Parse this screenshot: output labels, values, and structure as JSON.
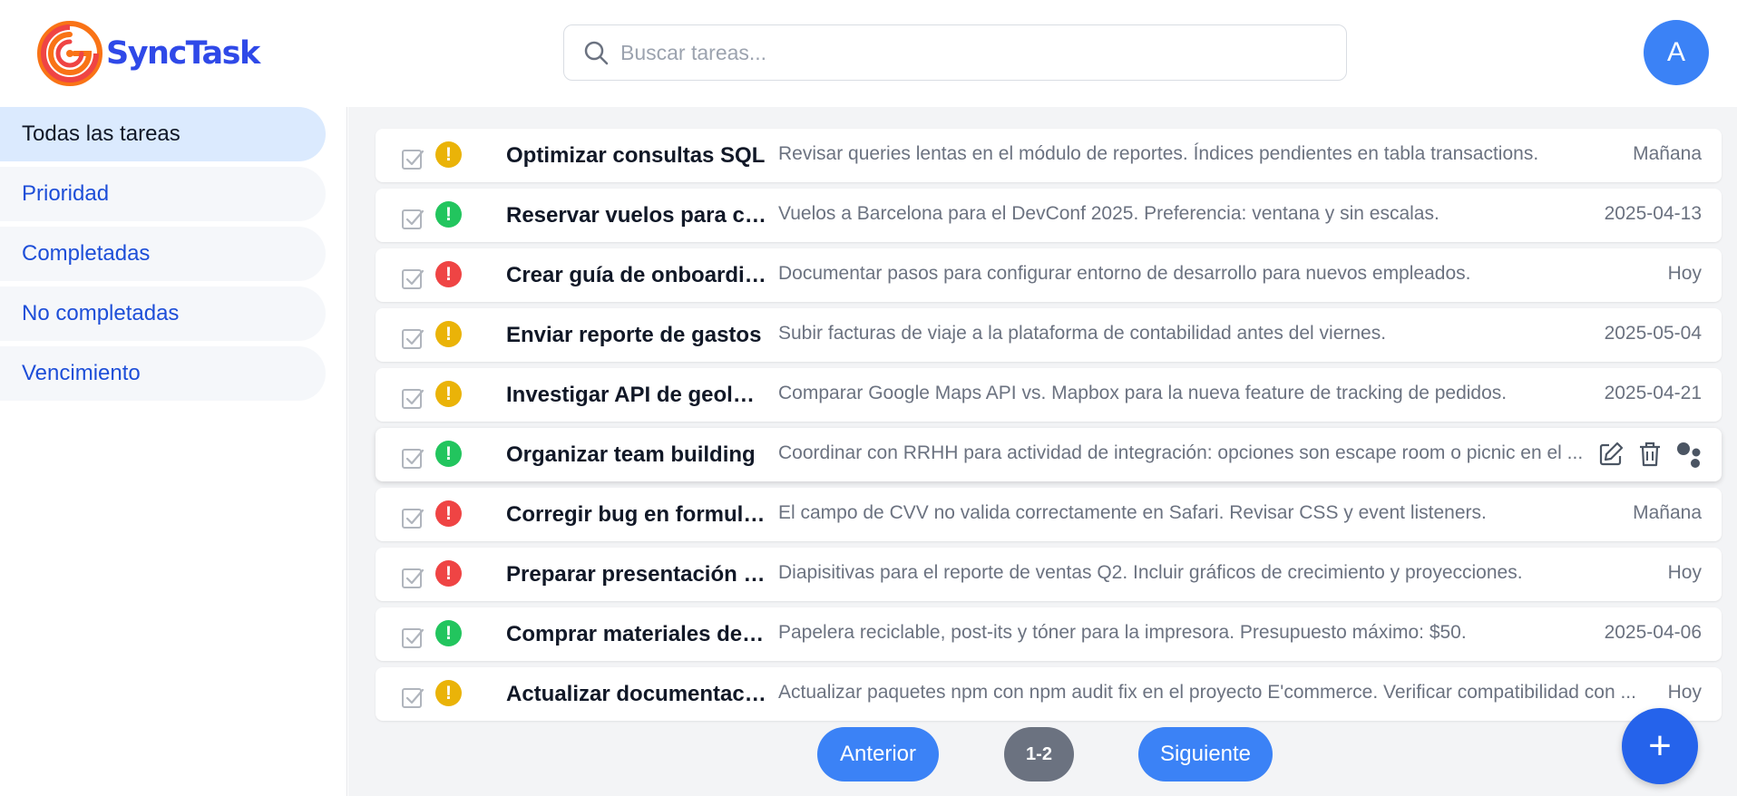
{
  "header": {
    "brand": "SyncTask",
    "search_placeholder": "Buscar tareas...",
    "avatar_initial": "A"
  },
  "sidebar": {
    "items": [
      {
        "label": "Todas las tareas",
        "active": true
      },
      {
        "label": "Prioridad",
        "active": false
      },
      {
        "label": "Completadas",
        "active": false
      },
      {
        "label": "No completadas",
        "active": false
      },
      {
        "label": "Vencimiento",
        "active": false
      }
    ]
  },
  "tasks": [
    {
      "title": "Optimizar consultas SQL",
      "description": "Revisar queries lentas en el módulo de reportes. Índices pendientes en tabla transactions.",
      "date": "Mañana",
      "priority": "medium"
    },
    {
      "title": "Reservar vuelos para co...",
      "description": "Vuelos a Barcelona para el DevConf 2025. Preferencia: ventana y sin escalas.",
      "date": "2025-04-13",
      "priority": "low"
    },
    {
      "title": "Crear guía de onboarding",
      "description": "Documentar pasos para configurar entorno de desarrollo para nuevos empleados.",
      "date": "Hoy",
      "priority": "high"
    },
    {
      "title": "Enviar reporte de gastos",
      "description": "Subir facturas de viaje a la plataforma de contabilidad antes del viernes.",
      "date": "2025-05-04",
      "priority": "medium"
    },
    {
      "title": "Investigar API de geoloc...",
      "description": "Comparar Google Maps API vs. Mapbox para la nueva feature de tracking de pedidos.",
      "date": "2025-04-21",
      "priority": "medium"
    },
    {
      "title": "Organizar team building",
      "description": "Coordinar con RRHH para actividad de integración: opciones son escape room o picnic en el ...",
      "date": "",
      "priority": "low",
      "hovered": true
    },
    {
      "title": "Corregir bug en formula...",
      "description": "El campo de CVV no valida correctamente en Safari. Revisar CSS y event listeners.",
      "date": "Mañana",
      "priority": "high"
    },
    {
      "title": "Preparar presentación m...",
      "description": "Diapisitivas para el reporte de ventas Q2. Incluir gráficos de crecimiento y proyecciones.",
      "date": "Hoy",
      "priority": "high"
    },
    {
      "title": "Comprar materiales de o...",
      "description": "Papelera reciclable, post-its y tóner para la impresora. Presupuesto máximo: $50.",
      "date": "2025-04-06",
      "priority": "low"
    },
    {
      "title": "Actualizar documentaci...",
      "description": "Actualizar paquetes npm con npm audit fix en el proyecto E'commerce. Verificar compatibilidad con ...",
      "date": "Hoy",
      "priority": "medium"
    }
  ],
  "pagination": {
    "prev_label": "Anterior",
    "page_label": "1-2",
    "next_label": "Siguiente"
  },
  "fab_label": "+",
  "icons": {
    "checkbox": "checkbox-icon",
    "priority": "exclamation-icon",
    "edit": "edit-icon",
    "delete": "trash-icon",
    "assign": "users-icon",
    "search": "search-icon",
    "add": "plus-icon"
  },
  "colors": {
    "accent": "#3b82f6",
    "brand": "#2f49e8",
    "priority_high": "#ef4444",
    "priority_medium": "#eab308",
    "priority_low": "#22c55e"
  }
}
